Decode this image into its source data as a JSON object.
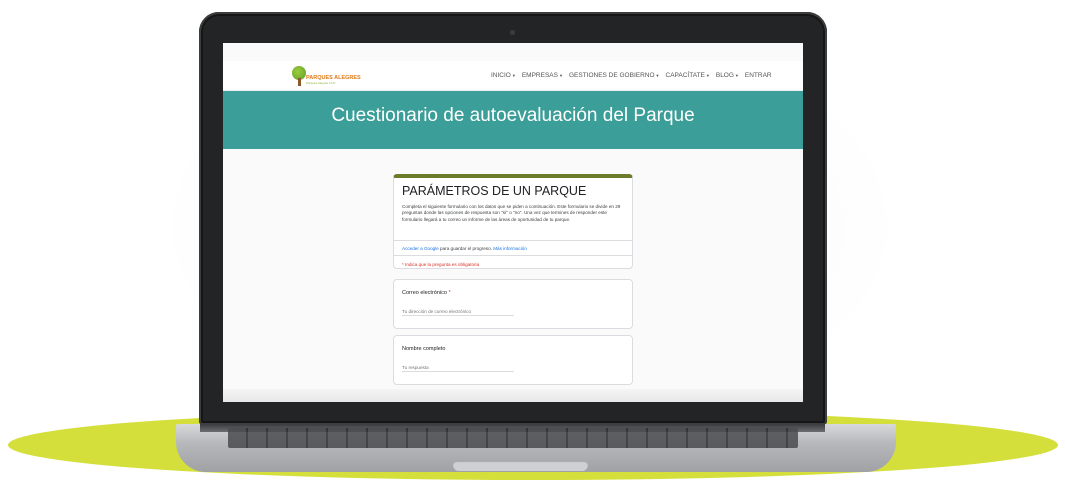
{
  "site": {
    "logo_text": "PARQUES ALEGRES",
    "logo_tagline": "Parques Alegres I.A.P."
  },
  "nav": {
    "items": [
      {
        "label": "INICIO",
        "has_dropdown": true
      },
      {
        "label": "EMPRESAS",
        "has_dropdown": true
      },
      {
        "label": "GESTIONES DE GOBIERNO",
        "has_dropdown": true
      },
      {
        "label": "CAPACÍTATE",
        "has_dropdown": true
      },
      {
        "label": "BLOG",
        "has_dropdown": true
      },
      {
        "label": "ENTRAR",
        "has_dropdown": false
      }
    ]
  },
  "banner": {
    "title": "Cuestionario de autoevaluación del Parque",
    "color": "#3b9e98"
  },
  "form": {
    "title": "PARÁMETROS DE UN PARQUE",
    "description": "Completa el siguiente formulario con los datos que se piden a continuación. Este formulario se divide en 29 preguntas donde las opciones de respuesta son \"sí\" o \"no\". Una vez que termines de responder este formulario llegará a tu correo un informe de las áreas de oportunidad de tu parque.",
    "signin_link": "Acceder a Google",
    "signin_text": " para guardar el progreso. ",
    "more_info_link": "Más información",
    "required_note": "* Indica que la pregunta es obligatoria",
    "accent_color": "#6b7c2c",
    "questions": [
      {
        "label": "Correo electrónico",
        "required": true,
        "placeholder": "Tu dirección de correo electrónico"
      },
      {
        "label": "Nombre completo",
        "required": false,
        "placeholder": "Tu respuesta"
      }
    ]
  },
  "decor": {
    "ellipse_color": "#d4df3c"
  }
}
